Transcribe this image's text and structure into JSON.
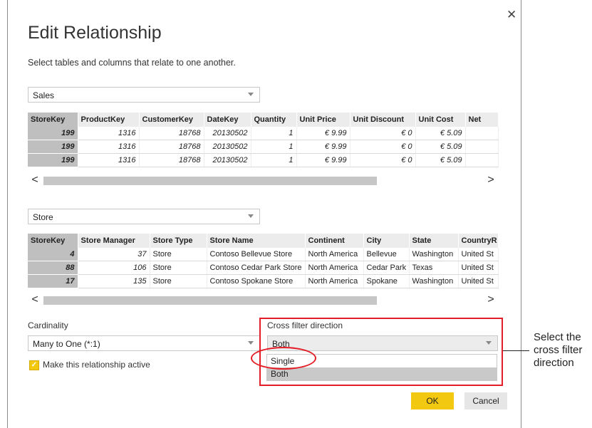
{
  "dialog": {
    "title": "Edit Relationship",
    "subtitle": "Select tables and columns that relate to one another.",
    "close_glyph": "✕"
  },
  "table1": {
    "name": "Sales",
    "columns": [
      "StoreKey",
      "ProductKey",
      "CustomerKey",
      "DateKey",
      "Quantity",
      "Unit Price",
      "Unit Discount",
      "Unit Cost",
      "Net"
    ],
    "rows": [
      [
        "199",
        "1316",
        "18768",
        "20130502",
        "1",
        "€ 9.99",
        "€ 0",
        "€ 5.09",
        ""
      ],
      [
        "199",
        "1316",
        "18768",
        "20130502",
        "1",
        "€ 9.99",
        "€ 0",
        "€ 5.09",
        ""
      ],
      [
        "199",
        "1316",
        "18768",
        "20130502",
        "1",
        "€ 9.99",
        "€ 0",
        "€ 5.09",
        ""
      ]
    ]
  },
  "table2": {
    "name": "Store",
    "columns": [
      "StoreKey",
      "Store Manager",
      "Store Type",
      "Store Name",
      "Continent",
      "City",
      "State",
      "CountryR"
    ],
    "rows": [
      [
        "4",
        "37",
        "Store",
        "Contoso Bellevue Store",
        "North America",
        "Bellevue",
        "Washington",
        "United St"
      ],
      [
        "88",
        "106",
        "Store",
        "Contoso Cedar Park Store",
        "North America",
        "Cedar Park",
        "Texas",
        "United St"
      ],
      [
        "17",
        "135",
        "Store",
        "Contoso Spokane Store",
        "North America",
        "Spokane",
        "Washington",
        "United St"
      ]
    ]
  },
  "scroll": {
    "left": "<",
    "right": ">"
  },
  "cardinality": {
    "label": "Cardinality",
    "value": "Many to One (*:1)"
  },
  "active_checkbox": {
    "label": "Make this relationship active",
    "checked": true
  },
  "cross_filter": {
    "label": "Cross filter direction",
    "value": "Both",
    "options": [
      "Single",
      "Both"
    ],
    "highlighted": "Both"
  },
  "buttons": {
    "ok": "OK",
    "cancel": "Cancel"
  },
  "annotation": {
    "callout": [
      "Select the",
      "cross filter",
      "direction"
    ],
    "highlight_color": "#e41e26"
  },
  "colors": {
    "accent": "#f2c811",
    "key_column": "#bfbfbf",
    "header": "#ececec"
  }
}
